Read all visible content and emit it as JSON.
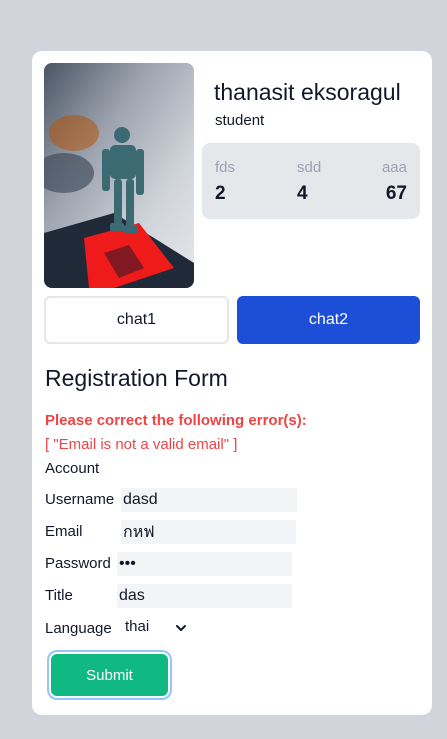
{
  "profile": {
    "name": "thanasit eksoragul",
    "role": "student",
    "stats": [
      {
        "label": "fds",
        "value": "2"
      },
      {
        "label": "sdd",
        "value": "4"
      },
      {
        "label": "aaa",
        "value": "67"
      }
    ]
  },
  "chat_buttons": {
    "chat1": "chat1",
    "chat2": "chat2"
  },
  "form": {
    "title": "Registration Form",
    "error_title": "Please correct the following error(s):",
    "error_message": "[ \"Email is not a valid email\" ]",
    "section_label": "Account",
    "fields": {
      "username": {
        "label": "Username",
        "value": "dasd"
      },
      "email": {
        "label": "Email",
        "value": "กหฟ"
      },
      "password": {
        "label": "Password",
        "value": "•••"
      },
      "title": {
        "label": "Title",
        "value": "das"
      },
      "language": {
        "label": "Language",
        "value": "thai"
      }
    },
    "submit_label": "Submit"
  },
  "colors": {
    "accent_blue": "#1d4ed8",
    "submit_green": "#10b981",
    "error_red": "#ef4444"
  }
}
